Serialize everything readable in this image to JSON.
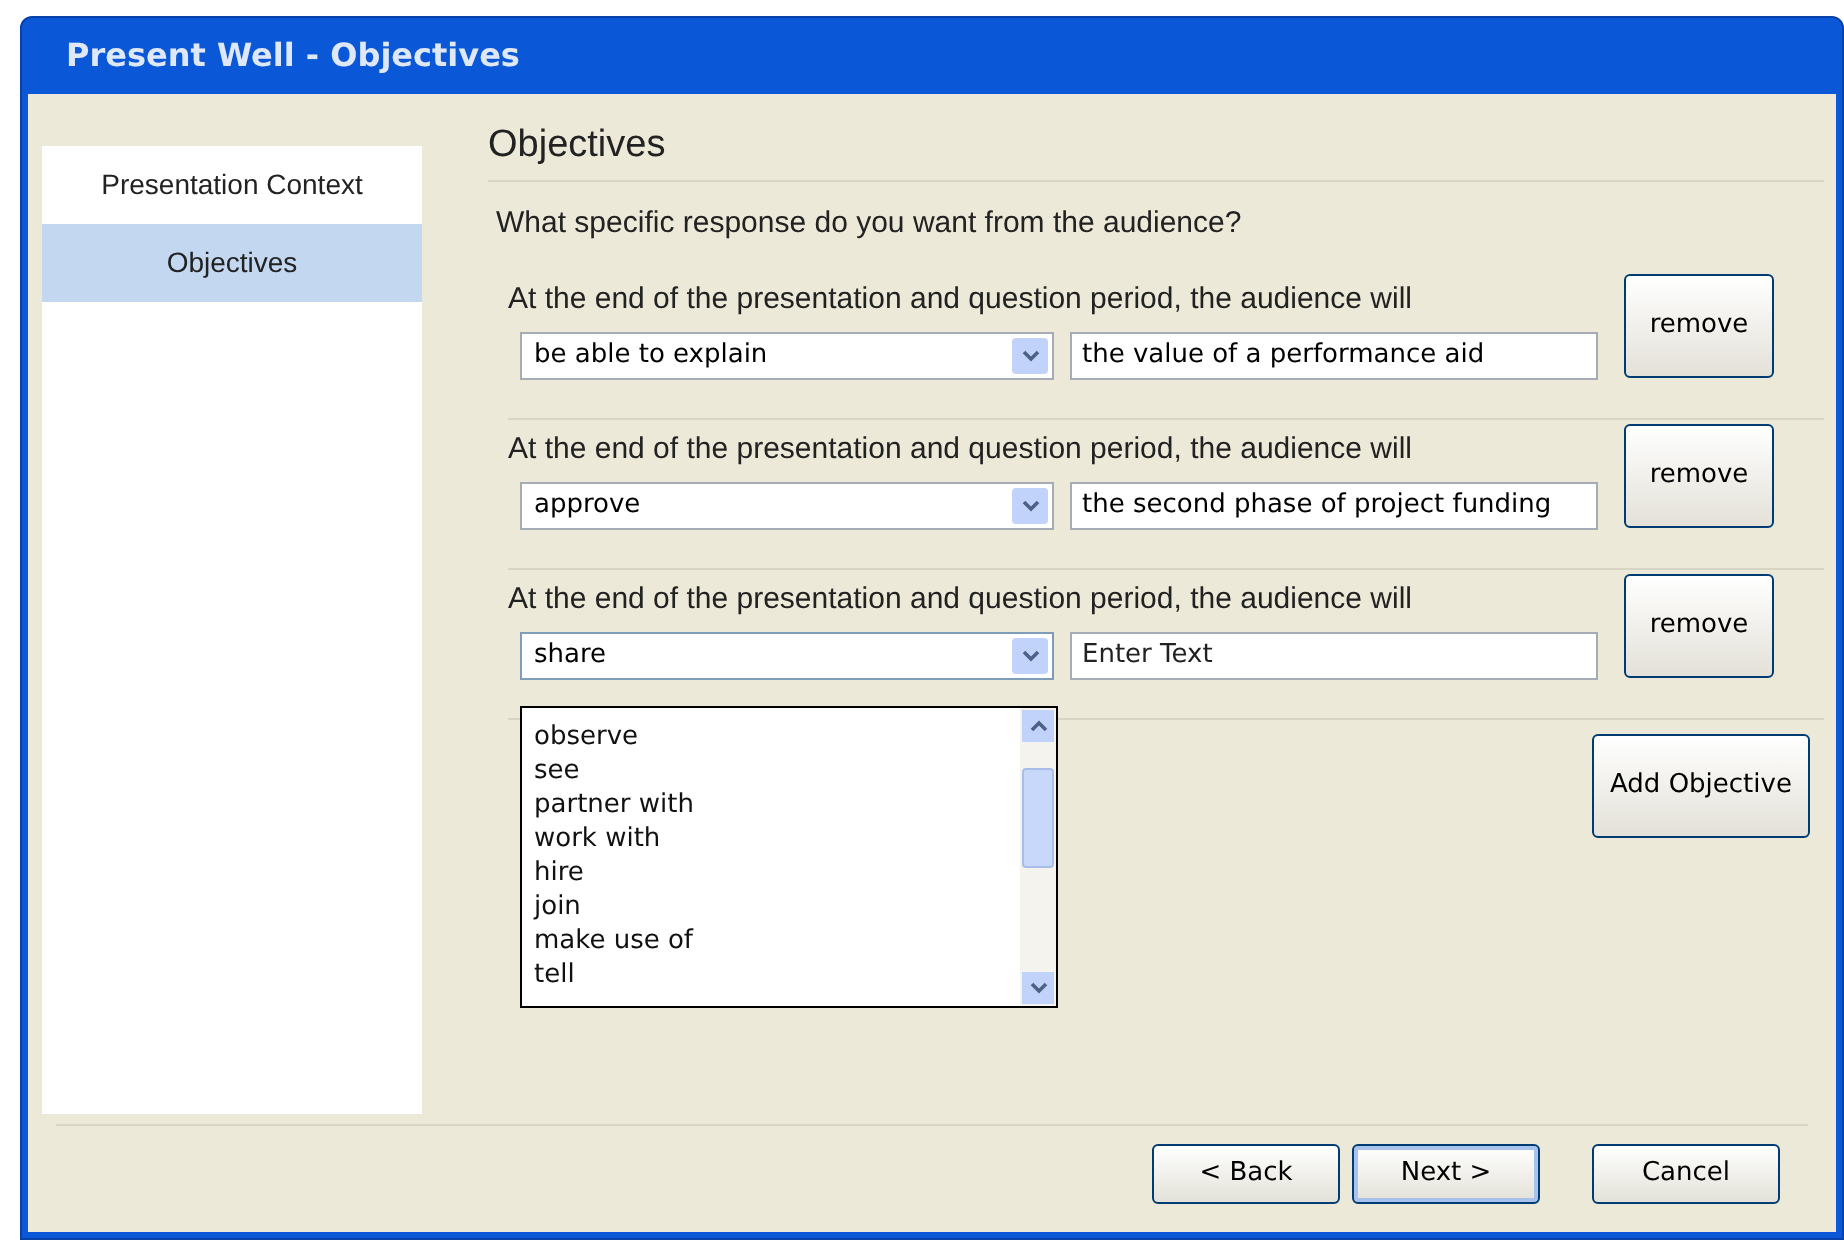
{
  "window": {
    "title": "Present Well - Objectives"
  },
  "sidebar": {
    "items": [
      {
        "label": "Presentation Context",
        "selected": false
      },
      {
        "label": "Objectives",
        "selected": true
      }
    ]
  },
  "heading": "Objectives",
  "question": "What specific response do you want from the audience?",
  "objectives": [
    {
      "prompt": "At the end of the presentation and question period, the audience will",
      "verb": "be able to explain",
      "text": "the value of a performance aid",
      "remove": "remove",
      "open": false
    },
    {
      "prompt": "At the end of the presentation and question period, the audience will",
      "verb": "approve",
      "text": "the second phase of project funding",
      "remove": "remove",
      "open": false
    },
    {
      "prompt": "At the end of the presentation and question period, the audience will",
      "verb": "share",
      "placeholder": "Enter Text",
      "remove": "remove",
      "open": true
    }
  ],
  "dropdown_options": [
    "observe",
    "see",
    "partner with",
    "work with",
    "hire",
    "join",
    "make use of",
    "tell"
  ],
  "add_button": "Add Objective",
  "buttons": [
    {
      "label": "< Back",
      "default": false
    },
    {
      "label": "Next >",
      "default": true
    },
    {
      "label": "Cancel",
      "default": false
    }
  ]
}
